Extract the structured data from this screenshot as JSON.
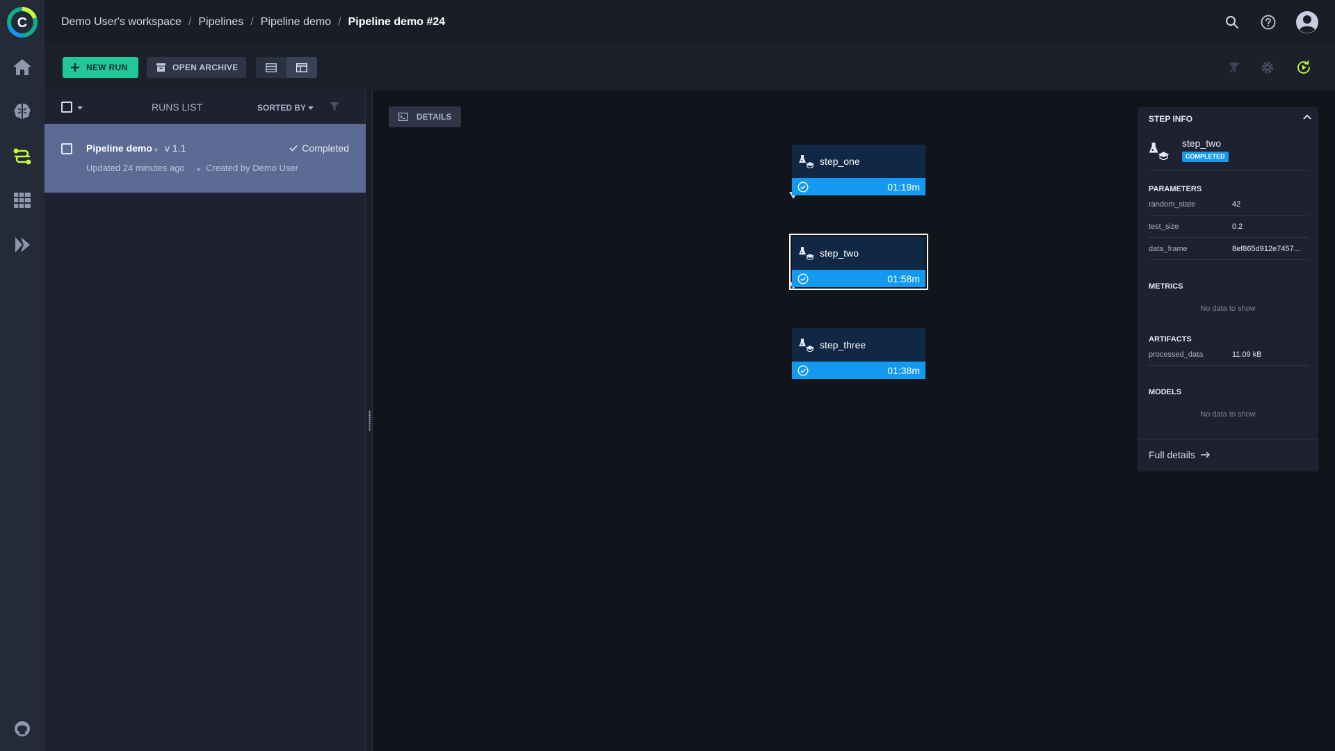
{
  "breadcrumb": {
    "items": [
      "Demo User's workspace",
      "Pipelines",
      "Pipeline demo"
    ],
    "current": "Pipeline demo #24",
    "separator": "/"
  },
  "toolbar": {
    "new_run_label": "NEW RUN",
    "open_archive_label": "OPEN ARCHIVE"
  },
  "runs_list": {
    "title": "RUNS LIST",
    "sorted_by_label": "SORTED BY",
    "runs": [
      {
        "name": "Pipeline demo",
        "version": "v 1.1",
        "status": "Completed",
        "updated": "Updated 24 minutes ago",
        "created_by": "Created by Demo User"
      }
    ]
  },
  "dag": {
    "details_label": "DETAILS",
    "steps": [
      {
        "name": "step_one",
        "duration": "01:19m",
        "status": "completed"
      },
      {
        "name": "step_two",
        "duration": "01:58m",
        "status": "completed",
        "selected": true
      },
      {
        "name": "step_three",
        "duration": "01:38m",
        "status": "completed"
      }
    ]
  },
  "step_info": {
    "title": "STEP INFO",
    "step_name": "step_two",
    "status_badge": "COMPLETED",
    "parameters_label": "PARAMETERS",
    "parameters": [
      {
        "key": "random_state",
        "value": "42"
      },
      {
        "key": "test_size",
        "value": "0.2"
      },
      {
        "key": "data_frame",
        "value": "8ef865d912e7457..."
      }
    ],
    "metrics_label": "METRICS",
    "metrics_empty": "No data to show",
    "artifacts_label": "ARTIFACTS",
    "artifacts": [
      {
        "key": "processed_data",
        "value": "11.09 kB"
      }
    ],
    "models_label": "MODELS",
    "models_empty": "No data to show",
    "full_details_label": "Full details"
  },
  "colors": {
    "accent_green": "#20c79a",
    "step_blue": "#139af0",
    "selected_run_bg": "#5b6b94",
    "nav_active": "#c6ff3a"
  },
  "icons": {
    "nav": [
      "home-icon",
      "brain-icon",
      "pipelines-icon",
      "datasets-icon",
      "deploy-icon",
      "github-icon"
    ],
    "header": [
      "search-icon",
      "help-icon",
      "user-avatar-icon"
    ]
  }
}
